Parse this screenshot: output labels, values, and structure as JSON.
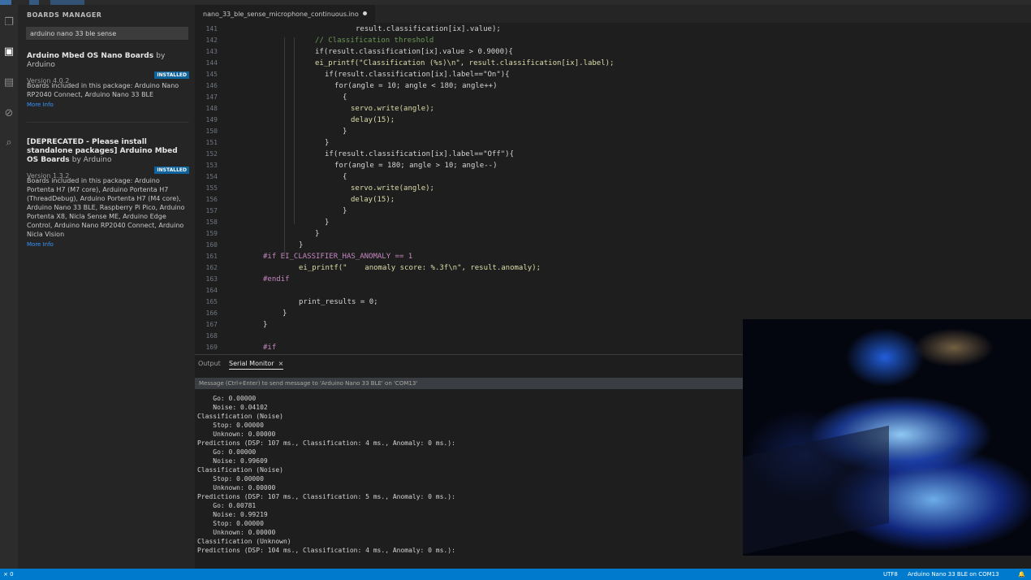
{
  "sidebar": {
    "title": "BOARDS MANAGER",
    "search_value": "arduino nano 33 ble sense",
    "packages": [
      {
        "name": "Arduino Mbed OS Nano Boards",
        "by": "by Arduino",
        "version": "Version 4.0.2",
        "badge": "INSTALLED",
        "description": "Boards included in this package: Arduino Nano RP2040 Connect, Arduino Nano 33 BLE",
        "more": "More Info"
      },
      {
        "name": "[DEPRECATED - Please install standalone packages] Arduino Mbed OS Boards",
        "by": "by Arduino",
        "version": "Version 1.3.2",
        "badge": "INSTALLED",
        "description": "Boards included in this package: Arduino Portenta H7 (M7 core), Arduino Portenta H7 (ThreadDebug), Arduino Portenta H7 (M4 core), Arduino Nano 33 BLE, Raspberry Pi Pico, Arduino Portenta X8, Nicla Sense ME, Arduino Edge Control, Arduino Nano RP2040 Connect, Arduino Nicla Vision",
        "more": "More Info"
      }
    ]
  },
  "editor": {
    "tab_label": "nano_33_ble_sense_microphone_continuous.ino",
    "lines": [
      {
        "n": "141",
        "t": "result.classification[ix].value);"
      },
      {
        "n": "142",
        "t": "// Classification threshold"
      },
      {
        "n": "143",
        "t": "if(result.classification[ix].value > 0.9000){"
      },
      {
        "n": "144",
        "t": "ei_printf(\"Classification (%s)\\n\", result.classification[ix].label);"
      },
      {
        "n": "145",
        "t": "if(result.classification[ix].label==\"On\"){"
      },
      {
        "n": "146",
        "t": "for(angle = 10; angle < 180; angle++)"
      },
      {
        "n": "147",
        "t": "{"
      },
      {
        "n": "148",
        "t": "servo.write(angle);"
      },
      {
        "n": "149",
        "t": "delay(15);"
      },
      {
        "n": "150",
        "t": "}"
      },
      {
        "n": "151",
        "t": "}"
      },
      {
        "n": "152",
        "t": "if(result.classification[ix].label==\"Off\"){"
      },
      {
        "n": "153",
        "t": "for(angle = 180; angle > 10; angle--)"
      },
      {
        "n": "154",
        "t": "{"
      },
      {
        "n": "155",
        "t": "servo.write(angle);"
      },
      {
        "n": "156",
        "t": "delay(15);"
      },
      {
        "n": "157",
        "t": "}"
      },
      {
        "n": "158",
        "t": "}"
      },
      {
        "n": "159",
        "t": "}"
      },
      {
        "n": "160",
        "t": "}"
      },
      {
        "n": "161",
        "t": "#if EI_CLASSIFIER_HAS_ANOMALY == 1"
      },
      {
        "n": "162",
        "t": "ei_printf(\"    anomaly score: %.3f\\n\", result.anomaly);"
      },
      {
        "n": "163",
        "t": "#endif"
      },
      {
        "n": "164",
        "t": ""
      },
      {
        "n": "165",
        "t": "print_results = 0;"
      },
      {
        "n": "166",
        "t": "}"
      },
      {
        "n": "167",
        "t": "}"
      },
      {
        "n": "168",
        "t": ""
      },
      {
        "n": "169",
        "t": "#if"
      }
    ]
  },
  "panel": {
    "tabs": [
      "Output",
      "Serial Monitor"
    ],
    "close_glyph": "×",
    "message": "Message (Ctrl+Enter) to send message to 'Arduino Nano 33 BLE' on 'COM13'",
    "output_lines": [
      "    Go: 0.00000",
      "    Noise: 0.04102",
      "Classification (Noise)",
      "    Stop: 0.00000",
      "    Unknown: 0.00000",
      "Predictions (DSP: 107 ms., Classification: 4 ms., Anomaly: 0 ms.):",
      "    Go: 0.00000",
      "    Noise: 0.99609",
      "Classification (Noise)",
      "    Stop: 0.00000",
      "    Unknown: 0.00000",
      "Predictions (DSP: 107 ms., Classification: 5 ms., Anomaly: 0 ms.):",
      "    Go: 0.00781",
      "    Noise: 0.99219",
      "    Stop: 0.00000",
      "    Unknown: 0.00000",
      "Classification (Unknown)",
      "Predictions (DSP: 104 ms., Classification: 4 ms., Anomaly: 0 ms.):"
    ]
  },
  "statusbar": {
    "left": "⨯ 0",
    "right_items": [
      "UTF8",
      "Arduino Nano 33 BLE on COM13",
      "🔔"
    ]
  },
  "colors": {
    "accent": "#007acc",
    "keyword": "#c586c0",
    "function": "#dcdcaa",
    "string": "#ce9178",
    "number": "#b5cea8",
    "comment": "#6a9955"
  }
}
